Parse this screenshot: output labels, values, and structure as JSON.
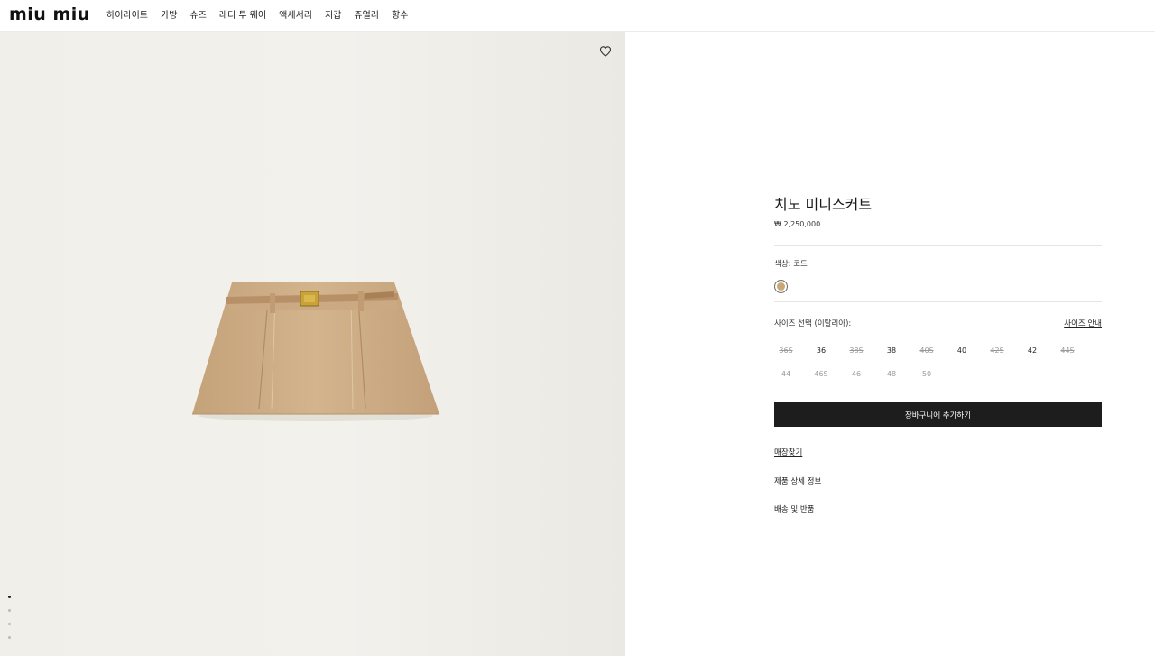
{
  "header": {
    "logo": "miu miu",
    "nav": [
      "하이라이트",
      "가방",
      "슈즈",
      "레디 투 웨어",
      "액세서리",
      "지갑",
      "쥬얼리",
      "향수"
    ]
  },
  "gallery": {
    "wishlist_icon": "heart-icon",
    "pager_count": 4,
    "active_index": 0
  },
  "product": {
    "title": "치노 미니스커트",
    "price": "₩ 2,250,000",
    "color_label": "색상:",
    "color_value": "코드",
    "swatch_color": "#c9a877",
    "size_label": "사이즈 선택 (이탈리아):",
    "size_guide": "사이즈 안내",
    "sizes": [
      {
        "label": "36S",
        "available": false
      },
      {
        "label": "36",
        "available": true
      },
      {
        "label": "38S",
        "available": false
      },
      {
        "label": "38",
        "available": true
      },
      {
        "label": "40S",
        "available": false
      },
      {
        "label": "40",
        "available": true
      },
      {
        "label": "42S",
        "available": false
      },
      {
        "label": "42",
        "available": true
      },
      {
        "label": "44S",
        "available": false
      },
      {
        "label": "44",
        "available": false
      },
      {
        "label": "46S",
        "available": false
      },
      {
        "label": "46",
        "available": false
      },
      {
        "label": "48",
        "available": false
      },
      {
        "label": "50",
        "available": false
      }
    ],
    "add_to_cart": "장바구니에 추가하기",
    "links": [
      "매장찾기",
      "제품 상세 정보",
      "배송 및 반품"
    ]
  }
}
